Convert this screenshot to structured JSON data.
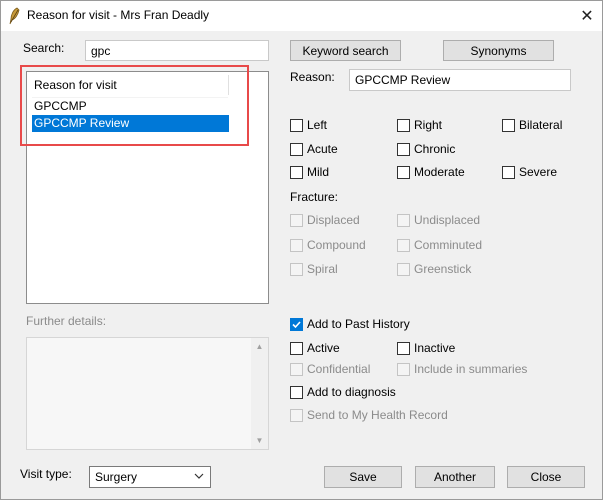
{
  "window": {
    "title": "Reason for visit - Mrs Fran Deadly",
    "close_glyph": "✕"
  },
  "search": {
    "label": "Search:",
    "value": "gpc"
  },
  "buttons": {
    "keyword_search": "Keyword search",
    "synonyms": "Synonyms",
    "save": "Save",
    "another": "Another",
    "close": "Close"
  },
  "list": {
    "header": "Reason for visit",
    "items": [
      "GPCCMP",
      "GPCCMP Review"
    ],
    "selected_index": 1
  },
  "reason": {
    "label": "Reason:",
    "value": "GPCCMP Review"
  },
  "modifiers": {
    "left": "Left",
    "right": "Right",
    "bilateral": "Bilateral",
    "acute": "Acute",
    "chronic": "Chronic",
    "mild": "Mild",
    "moderate": "Moderate",
    "severe": "Severe"
  },
  "fracture": {
    "label": "Fracture:",
    "displaced": "Displaced",
    "undisplaced": "Undisplaced",
    "compound": "Compound",
    "comminuted": "Comminuted",
    "spiral": "Spiral",
    "greenstick": "Greenstick"
  },
  "further_details": {
    "label": "Further details:",
    "value": ""
  },
  "history": {
    "add_to_past_history": "Add to Past History",
    "add_to_past_history_checked": true,
    "active": "Active",
    "inactive": "Inactive",
    "confidential": "Confidential",
    "include_in_summaries": "Include in summaries",
    "add_to_diagnosis": "Add to diagnosis",
    "send_to_my_health_record": "Send to My Health Record"
  },
  "visit_type": {
    "label": "Visit type:",
    "value": "Surgery"
  },
  "colors": {
    "selection": "#0078d7",
    "highlight_border": "#e84a4a"
  }
}
